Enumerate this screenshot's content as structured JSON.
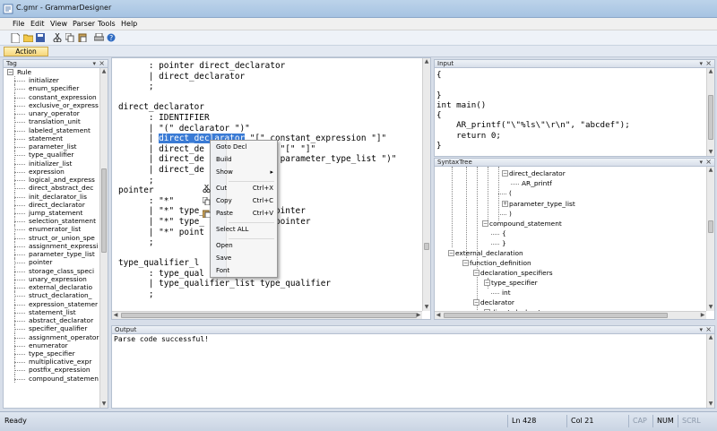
{
  "app": {
    "title": "C.gmr - GrammarDesigner"
  },
  "menu": [
    "File",
    "Edit",
    "View",
    "Parser",
    "Tools",
    "Help"
  ],
  "toolbar": {
    "icons": [
      "new-icon",
      "open-icon",
      "save-icon",
      "cut-icon",
      "copy-icon",
      "paste-icon",
      "print-icon",
      "help-icon"
    ]
  },
  "action_tab": "Action",
  "tag_panel": {
    "title": "Tag",
    "root": "Rule",
    "items": [
      "initializer",
      "enum_specifier",
      "constant_expression",
      "exclusive_or_express",
      "unary_operator",
      "translation_unit",
      "labeled_statement",
      "statement",
      "parameter_list",
      "type_qualifier",
      "initializer_list",
      "expression",
      "logical_and_express",
      "direct_abstract_dec",
      "init_declarator_lis",
      "direct_declarator",
      "jump_statement",
      "selection_statement",
      "enumerator_list",
      "struct_or_union_spe",
      "assignment_expressi",
      "parameter_type_list",
      "pointer",
      "storage_class_speci",
      "unary_expression",
      "external_declaratio",
      "struct_declaration_",
      "expression_statemer",
      "statement_list",
      "abstract_declarator",
      "specifier_qualifier",
      "assignment_operator",
      "enumerator",
      "type_specifier",
      "multiplicative_expr",
      "postfix_expression",
      "compound_statemen"
    ]
  },
  "editor": {
    "lines": [
      {
        "pre": "      : pointer direct_declarator"
      },
      {
        "pre": "      | direct_declarator"
      },
      {
        "pre": "      ;"
      },
      {
        "pre": ""
      },
      {
        "pre": "direct_declarator"
      },
      {
        "pre": "      : IDENTIFIER"
      },
      {
        "pre": "      | \"(\" declarator \")\""
      },
      {
        "pre": "      | ",
        "sel": "direct_declarator",
        "post": " \"[\" constant_expression \"]\""
      },
      {
        "pre": "      | direct_de",
        "post": "               \"[\" \"]\""
      },
      {
        "pre": "      | direct_de",
        "post": "               parameter_type_list \")\""
      },
      {
        "pre": "      | direct_de",
        "post": ""
      },
      {
        "pre": "      ;"
      },
      {
        "pre": "pointer"
      },
      {
        "pre": "      : \"*\""
      },
      {
        "pre": "      | \"*\" type_",
        "post": "              ointer"
      },
      {
        "pre": "      | \"*\" type_",
        "post": "              pointer"
      },
      {
        "pre": "      | \"*\" point"
      },
      {
        "pre": "      ;"
      },
      {
        "pre": ""
      },
      {
        "pre": "type_qualifier_l"
      },
      {
        "pre": "      : type_qual"
      },
      {
        "pre": "      | type_qualifier_list type_qualifier"
      },
      {
        "pre": "      ;"
      }
    ]
  },
  "context_menu": {
    "items": [
      {
        "label": "Goto Decl",
        "shortcut": ""
      },
      {
        "label": "Build",
        "shortcut": ""
      },
      {
        "label": "Show",
        "shortcut": "▸"
      },
      {
        "label": "Cut",
        "shortcut": "Ctrl+X"
      },
      {
        "label": "Copy",
        "shortcut": "Ctrl+C"
      },
      {
        "label": "Paste",
        "shortcut": "Ctrl+V"
      },
      {
        "label": "Select ALL",
        "shortcut": ""
      },
      {
        "label": "Open",
        "shortcut": ""
      },
      {
        "label": "Save",
        "shortcut": ""
      },
      {
        "label": "Font",
        "shortcut": ""
      }
    ]
  },
  "input_panel": {
    "title": "Input",
    "lines": [
      "{",
      "",
      "}",
      "int main()",
      "{",
      "    AR_printf(\"\\\"%ls\\\"\\r\\n\", \"abcdef\");",
      "    return 0;",
      "}"
    ]
  },
  "syntax_panel": {
    "title": "SyntaxTree",
    "nodes": [
      "direct_declarator",
      "AR_printf",
      "(",
      "parameter_type_list",
      ")",
      "compound_statement",
      "{",
      "}",
      "external_declaration",
      "function_definition",
      "declaration_specifiers",
      "type_specifier",
      "int",
      "declarator",
      "direct_declarator"
    ]
  },
  "output_panel": {
    "title": "Output",
    "text": "Parse code successful!"
  },
  "status": {
    "ready": "Ready",
    "ln": "Ln 428",
    "col": "Col 21",
    "cap": "CAP",
    "num": "NUM",
    "scrl": "SCRL"
  }
}
